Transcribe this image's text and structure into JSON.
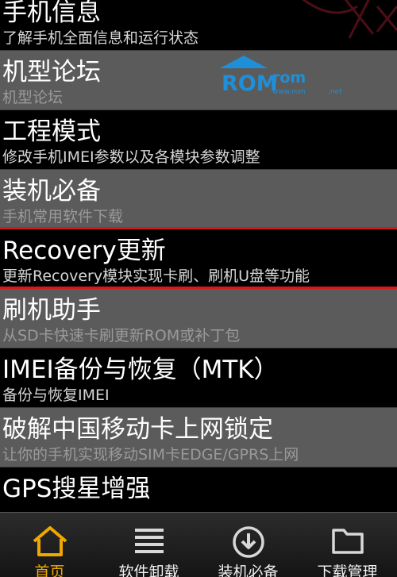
{
  "menu": [
    {
      "title": "手机信息",
      "desc": "了解手机全面信息和运行状态"
    },
    {
      "title": "机型论坛",
      "desc": "机型论坛"
    },
    {
      "title": "工程模式",
      "desc": "修改手机IMEI参数以及各模块参数调整"
    },
    {
      "title": "装机必备",
      "desc": "手机常用软件下载"
    },
    {
      "title": "Recovery更新",
      "desc": "更新Recovery模块实现卡刷、刷机U盘等功能"
    },
    {
      "title": "刷机助手",
      "desc": "从SD卡快速卡刷更新ROM或补丁包"
    },
    {
      "title": "IMEI备份与恢复（MTK）",
      "desc": "备份与恢复IMEI"
    },
    {
      "title": "破解中国移动卡上网锁定",
      "desc": "让你的手机实现移动SIM卡EDGE/GPRS上网"
    },
    {
      "title": "GPS搜星增强",
      "desc": ""
    }
  ],
  "watermark": {
    "logo_left": "ROM",
    "logo_right": "rom",
    "url_left": "www.rom",
    "url_right": ".net"
  },
  "tabs": [
    {
      "label": "首页",
      "icon": "home-icon",
      "active": true
    },
    {
      "label": "软件卸载",
      "icon": "list-icon",
      "active": false
    },
    {
      "label": "装机必备",
      "icon": "download-icon",
      "active": false
    },
    {
      "label": "下载管理",
      "icon": "folder-icon",
      "active": false
    }
  ],
  "colors": {
    "active_tab": "#f0a800",
    "accent_red": "#d11a1a",
    "logo_blue": "#1e8fd8"
  }
}
